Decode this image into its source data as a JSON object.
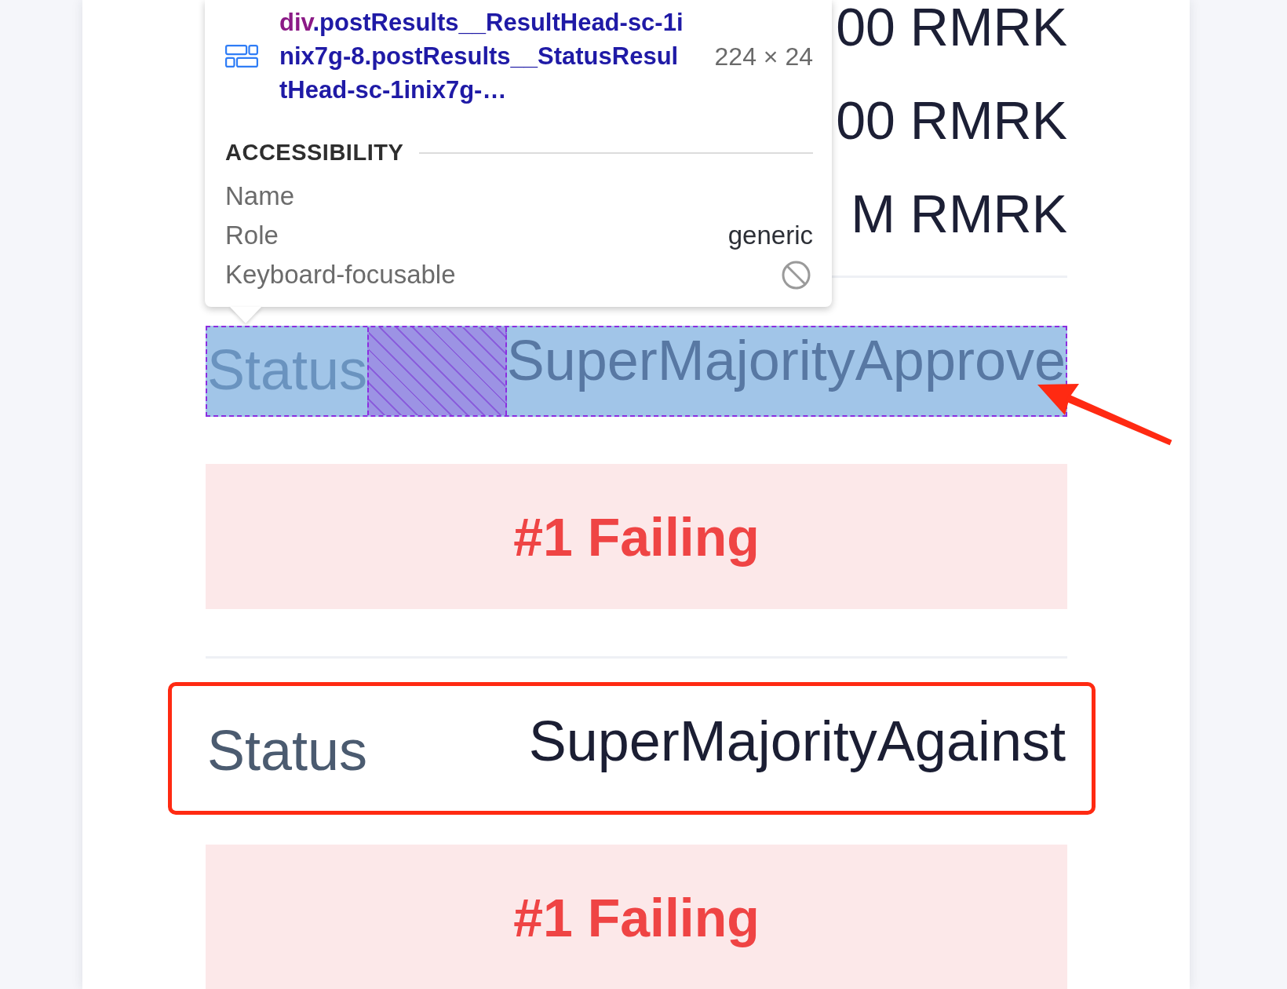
{
  "devtools_tooltip": {
    "tag": "div",
    "selector": ".postResults__ResultHead-sc-1inix7g-8.postResults__StatusResultHead-sc-1inix7g-…",
    "size": "224 × 24",
    "section_title": "ACCESSIBILITY",
    "properties": [
      {
        "kind": "text",
        "label": "Name"
      },
      {
        "kind": "text",
        "label": "Role",
        "value": "generic"
      },
      {
        "kind": "boolean",
        "label": "Keyboard-focusable",
        "on": false
      }
    ]
  },
  "amounts": [
    "00 RMRK",
    "00 RMRK",
    "M RMRK"
  ],
  "results": [
    {
      "status_label": "Status",
      "status": "SuperMajorityApprove",
      "highlighted": true,
      "arrow": true,
      "boxed": false,
      "outcome": {
        "kind": "failing",
        "text": "#1 Failing"
      }
    },
    {
      "status_label": "Status",
      "status": "SuperMajorityAgainst",
      "highlighted": false,
      "arrow": false,
      "boxed": true,
      "outcome": {
        "kind": "failing",
        "text": "#1 Failing"
      }
    }
  ]
}
